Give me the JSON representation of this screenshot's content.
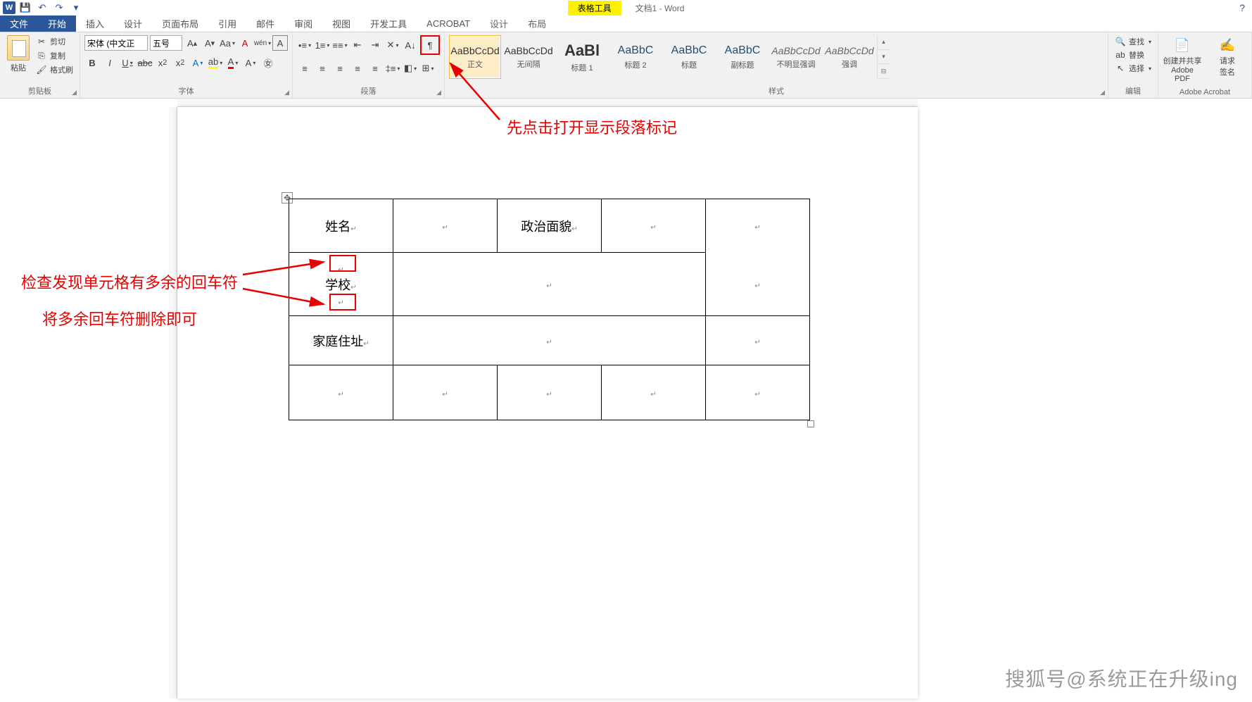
{
  "titlebar": {
    "table_tools": "表格工具",
    "doc_title": "文档1 - Word"
  },
  "tabs": {
    "file": "文件",
    "home": "开始",
    "insert": "插入",
    "design": "设计",
    "layout": "页面布局",
    "references": "引用",
    "mailings": "邮件",
    "review": "审阅",
    "view": "视图",
    "developer": "开发工具",
    "acrobat": "ACROBAT",
    "table_design": "设计",
    "table_layout": "布局"
  },
  "clipboard": {
    "paste": "粘贴",
    "cut": "剪切",
    "copy": "复制",
    "format_painter": "格式刷",
    "group": "剪贴板"
  },
  "font": {
    "name": "宋体 (中文正",
    "size": "五号",
    "group": "字体"
  },
  "paragraph": {
    "group": "段落"
  },
  "styles": {
    "preview": "AaBbCcDd",
    "preview_big": "AaBl",
    "preview_med": "AaBbC",
    "normal": "正文",
    "no_spacing": "无间隔",
    "heading1": "标题 1",
    "heading2": "标题 2",
    "title": "标题",
    "subtitle": "副标题",
    "subtle_emphasis": "不明显强调",
    "emphasis": "强调",
    "group": "样式"
  },
  "editing": {
    "find": "查找",
    "replace": "替换",
    "select": "选择",
    "group": "编辑"
  },
  "adobe": {
    "create_share": "创建并共享",
    "adobe_pdf": "Adobe PDF",
    "request": "请求",
    "signature": "签名",
    "group": "Adobe Acrobat"
  },
  "table": {
    "r1c1": "姓名",
    "r1c3": "政治面貌",
    "r2c1": "学校",
    "r3c1": "家庭住址"
  },
  "annotations": {
    "top": "先点击打开显示段落标记",
    "left1": "检查发现单元格有多余的回车符",
    "left2": "将多余回车符删除即可"
  },
  "watermark": "搜狐号@系统正在升级ing"
}
